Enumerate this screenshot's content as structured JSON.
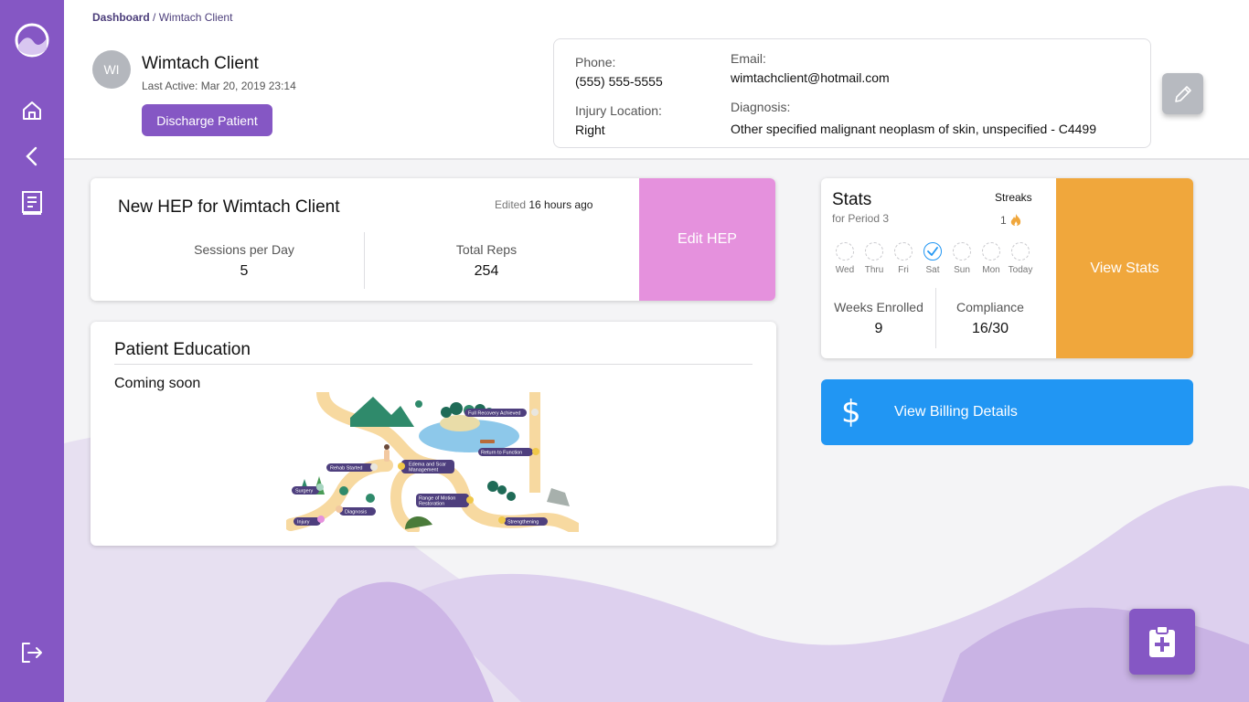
{
  "breadcrumb": {
    "root": "Dashboard",
    "separator": "/",
    "current": "Wimtach Client"
  },
  "sidebar": {
    "logo": "wave-logo-icon",
    "items": [
      {
        "name": "home-icon"
      },
      {
        "name": "back-chevron-icon"
      },
      {
        "name": "notes-icon"
      }
    ],
    "logout": "logout-icon"
  },
  "client": {
    "initials": "WI",
    "name": "Wimtach Client",
    "last_active": "Last Active: Mar 20, 2019 23:14",
    "discharge_label": "Discharge Patient"
  },
  "info": {
    "phone_label": "Phone:",
    "phone": "(555) 555-5555",
    "email_label": "Email:",
    "email": "wimtachclient@hotmail.com",
    "injury_label": "Injury Location:",
    "injury": "Right",
    "diagnosis_label": "Diagnosis:",
    "diagnosis": "Other specified malignant neoplasm of skin, unspecified - C4499"
  },
  "hep": {
    "title": "New HEP for Wimtach Client",
    "edited_prefix": "Edited",
    "edited_time": "16 hours ago",
    "sessions_label": "Sessions per Day",
    "sessions_value": "5",
    "reps_label": "Total Reps",
    "reps_value": "254",
    "edit_label": "Edit HEP"
  },
  "education": {
    "title": "Patient Education",
    "status": "Coming soon",
    "map_labels": {
      "full_recovery": "Full Recovery Achieved",
      "return_function": "Return to Function",
      "edema": "Edema and Scar",
      "edema2": "Management",
      "rehab": "Rehab Started",
      "surgery": "Surgery",
      "rom": "Range of Motion",
      "rom2": "Restoration",
      "diagnosis": "Diagnosis",
      "injury": "Injury",
      "strengthening": "Strengthening"
    }
  },
  "stats": {
    "title": "Stats",
    "period": "for Period 3",
    "streaks_label": "Streaks",
    "streaks_value": "1",
    "days": [
      {
        "label": "Wed",
        "done": false
      },
      {
        "label": "Thru",
        "done": false
      },
      {
        "label": "Fri",
        "done": false
      },
      {
        "label": "Sat",
        "done": true
      },
      {
        "label": "Sun",
        "done": false
      },
      {
        "label": "Mon",
        "done": false
      },
      {
        "label": "Today",
        "done": false
      }
    ],
    "weeks_label": "Weeks Enrolled",
    "weeks_value": "9",
    "compliance_label": "Compliance",
    "compliance_value": "16/30",
    "view_label": "View Stats"
  },
  "billing": {
    "symbol": "$",
    "label": "View Billing Details"
  },
  "fab": {
    "icon": "clipboard-plus-icon"
  },
  "colors": {
    "primary": "#8557c4",
    "edit_hep": "#e591dd",
    "view_stats": "#f0a73c",
    "billing": "#2196f3",
    "check": "#2196f3"
  }
}
